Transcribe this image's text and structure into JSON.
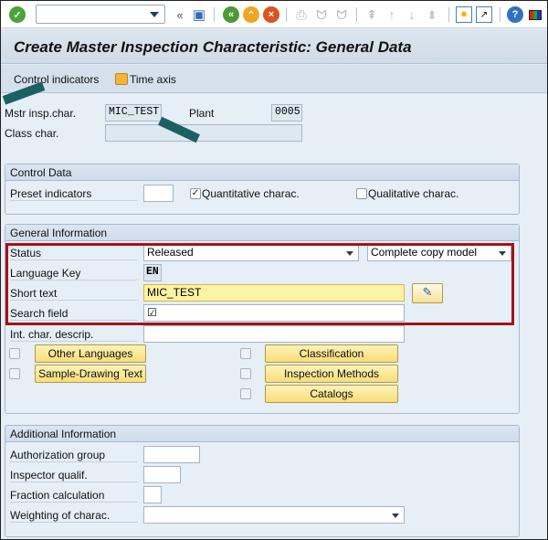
{
  "toolbar": {
    "command_field_value": "",
    "icons": [
      "enter-icon",
      "command-field-dropdown",
      "collapse-icon",
      "save-icon",
      "back-icon",
      "exit-icon",
      "cancel-icon",
      "print-icon",
      "find-icon",
      "find-next-icon",
      "first-page-icon",
      "previous-page-icon",
      "next-page-icon",
      "last-page-icon",
      "create-session-icon",
      "shortcut-icon",
      "help-icon",
      "customize-layout-icon"
    ]
  },
  "title": "Create Master Inspection Characteristic: General Data",
  "app_toolbar": {
    "control_indicators": "Control indicators",
    "time_axis": "Time axis"
  },
  "header": {
    "mstr_label": "Mstr insp.char.",
    "mstr_value": "MIC_TEST",
    "plant_label": "Plant",
    "plant_value": "0005",
    "class_label": "Class char.",
    "class_value": ""
  },
  "control_data": {
    "title": "Control Data",
    "preset_label": "Preset indicators",
    "preset_value": "",
    "quantitative_label": "Quantitative charac.",
    "quantitative_checked": true,
    "qualitative_label": "Qualitative charac.",
    "qualitative_checked": false
  },
  "general_info": {
    "title": "General Information",
    "status_label": "Status",
    "status_value": "Released",
    "copy_model_value": "Complete copy model",
    "language_label": "Language Key",
    "language_value": "EN",
    "short_text_label": "Short text",
    "short_text_value": "MIC_TEST",
    "search_field_label": "Search field",
    "search_field_value": "☑",
    "int_char_label": "Int. char. descrip.",
    "int_char_value": "",
    "buttons": {
      "other_languages": "Other Languages",
      "sample_drawing": "Sample-Drawing Text",
      "classification": "Classification",
      "inspection_methods": "Inspection Methods",
      "catalogs": "Catalogs"
    }
  },
  "additional_info": {
    "title": "Additional Information",
    "auth_group_label": "Authorization group",
    "auth_group_value": "",
    "inspector_label": "Inspector qualif.",
    "inspector_value": "",
    "fraction_label": "Fraction calculation",
    "fraction_value": "",
    "weighting_label": "Weighting of charac.",
    "weighting_value": ""
  }
}
